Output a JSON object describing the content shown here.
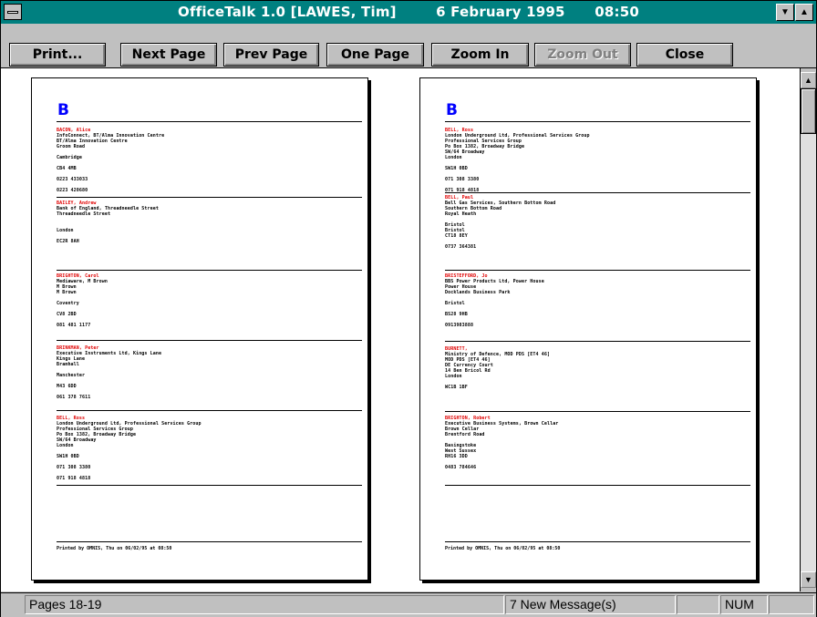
{
  "window": {
    "title": "OfficeTalk 1.0 [LAWES, Tim]",
    "date": "6 February 1995",
    "time": "08:50"
  },
  "toolbar": {
    "print": "Print...",
    "next_page": "Next Page",
    "prev_page": "Prev Page",
    "one_page": "One Page",
    "zoom_in": "Zoom In",
    "zoom_out": "Zoom Out",
    "close": "Close"
  },
  "pages": [
    {
      "letter": "B",
      "footer": "Printed by OMNIS, Thu on 06/02/95 at 08:50",
      "entries": [
        {
          "name": "BACON, Alice",
          "lines": [
            "InfoConnect, BT/Alma Innovation Centre",
            "BT/Alma Innovation Centre",
            "Groom Road",
            "",
            "Cambridge",
            "",
            "CB4 4MB",
            "",
            "0223 433033",
            "",
            "0223 420680"
          ]
        },
        {
          "name": "BAILEY, Andrew",
          "lines": [
            "Bank of England, Threadneedle Street",
            "Threadneedle Street",
            "",
            "",
            "London",
            "",
            "EC2R 8AH"
          ]
        },
        {
          "name": "BRIGHTON, Carol",
          "lines": [
            "Mediaware, M Brown",
            "M Brown",
            "M Brown",
            "",
            "Coventry",
            "",
            "CV8 2BD",
            "",
            "081 481 1177"
          ]
        },
        {
          "name": "BRINKMAN, Peter",
          "lines": [
            "Executive Instruments Ltd, Kings Lane",
            "Kings Lane",
            "Bramhall",
            "",
            "Manchester",
            "",
            "M43 6DD",
            "",
            "061 378 7611"
          ]
        },
        {
          "name": "BELL, Ross",
          "lines": [
            "London Underground Ltd, Professional Services Group",
            "Professional Services Group",
            "Po Box 1382, Broadway Bridge",
            "SW/64 Broadway",
            "London",
            "",
            "SW1H 0BD",
            "",
            "071 308 3380",
            "",
            "071 918 4818"
          ]
        }
      ]
    },
    {
      "letter": "B",
      "footer": "Printed by OMNIS, Thu on 06/02/95 at 08:50",
      "entries": [
        {
          "name": "BELL, Ross",
          "lines": [
            "London Underground Ltd, Professional Services Group",
            "Professional Services Group",
            "Po Box 1382, Broadway Bridge",
            "SW/64 Broadway",
            "London",
            "",
            "SW1H 0BD",
            "",
            "071 308 3380",
            "",
            "071 918 4818"
          ]
        },
        {
          "name": "BELL, Paul",
          "lines": [
            "Bell Gas Services, Southern Bottom Road",
            "Southern Bottom Road",
            "Royal Heath",
            "",
            "Bristol",
            "Bristol",
            "CT18 8EY",
            "",
            "0737 364381"
          ]
        },
        {
          "name": "BRISTEFFORD, Jo",
          "lines": [
            "BBS Power Products Ltd, Power House",
            "Power House",
            "Docklands Business Park",
            "",
            "Bristol",
            "",
            "BS28 9HB",
            "",
            "0913983888"
          ]
        },
        {
          "name": "BURNETT, ",
          "lines": [
            "Ministry of Defence, MOD PDS [ET4 46]",
            "MOD PDS [ET4 46]",
            "DE Currency Court",
            "14 Ben Bricol Rd",
            "London",
            "",
            "WC1B 1BF"
          ]
        },
        {
          "name": "BRIGHTON, Robert",
          "lines": [
            "Executive Business Systems, Brown Cellar",
            "Brown Cellar",
            "Brentford Road",
            "",
            "Basingstoke",
            "West Sussex",
            "RH16 3DD",
            "",
            "0483 784646"
          ]
        }
      ]
    }
  ],
  "status": {
    "pages": "Pages 18-19",
    "messages": "7 New Message(s)",
    "num": "NUM"
  }
}
